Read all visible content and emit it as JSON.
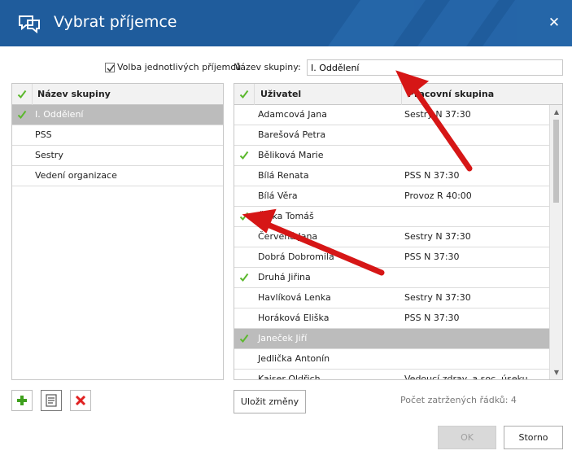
{
  "window": {
    "title": "Vybrat příjemce",
    "close_label": "✕"
  },
  "toolbar": {
    "individual_checkbox_label": "Volba jednotlivých příjemců",
    "individual_checked": true,
    "group_name_label": "Název skupiny:",
    "group_name_value": "I. Oddělení"
  },
  "groups": {
    "header": "Název skupiny",
    "rows": [
      {
        "name": "I. Oddělení",
        "checked": true,
        "selected": true
      },
      {
        "name": "PSS",
        "checked": false,
        "selected": false
      },
      {
        "name": "Sestry",
        "checked": false,
        "selected": false
      },
      {
        "name": "Vedení organizace",
        "checked": false,
        "selected": false
      }
    ]
  },
  "users": {
    "header_user": "Uživatel",
    "header_group": "Pracovní skupina",
    "rows": [
      {
        "user": "Adamcová Jana",
        "group": "Sestry N 37:30",
        "checked": false,
        "selected": false
      },
      {
        "user": "Barešová Petra",
        "group": "",
        "checked": false,
        "selected": false
      },
      {
        "user": "Běliková Marie",
        "group": "",
        "checked": true,
        "selected": false
      },
      {
        "user": "Bílá Renata",
        "group": "PSS N 37:30",
        "checked": false,
        "selected": false
      },
      {
        "user": "Bílá Věra",
        "group": "Provoz R 40:00",
        "checked": false,
        "selected": false
      },
      {
        "user": "Čejka Tomáš",
        "group": "",
        "checked": true,
        "selected": false
      },
      {
        "user": "Červená Jana",
        "group": "Sestry N 37:30",
        "checked": false,
        "selected": false
      },
      {
        "user": "Dobrá Dobromila",
        "group": "PSS N 37:30",
        "checked": false,
        "selected": false
      },
      {
        "user": "Druhá Jiřina",
        "group": "",
        "checked": true,
        "selected": false
      },
      {
        "user": "Havlíková Lenka",
        "group": "Sestry N 37:30",
        "checked": false,
        "selected": false
      },
      {
        "user": "Horáková Eliška",
        "group": "PSS N 37:30",
        "checked": false,
        "selected": false
      },
      {
        "user": "Janeček Jiří",
        "group": "",
        "checked": true,
        "selected": true
      },
      {
        "user": "Jedlička Antonín",
        "group": "",
        "checked": false,
        "selected": false
      },
      {
        "user": "Kaiser Oldřich",
        "group": "Vedoucí zdrav. a soc. úseku",
        "checked": false,
        "selected": false
      }
    ]
  },
  "buttons": {
    "save_changes": "Uložit změny",
    "ok": "OK",
    "cancel": "Storno"
  },
  "status": {
    "checked_rows": "Počet zatržených řádků: 4"
  },
  "colors": {
    "titlebar": "#1f5c9c",
    "check": "#5cb82e",
    "selected_row": "#bcbcbc",
    "arrow": "#d61616"
  },
  "icons": [
    "chat-icon",
    "close-icon",
    "add-icon",
    "edit-icon",
    "delete-icon",
    "check-icon"
  ]
}
